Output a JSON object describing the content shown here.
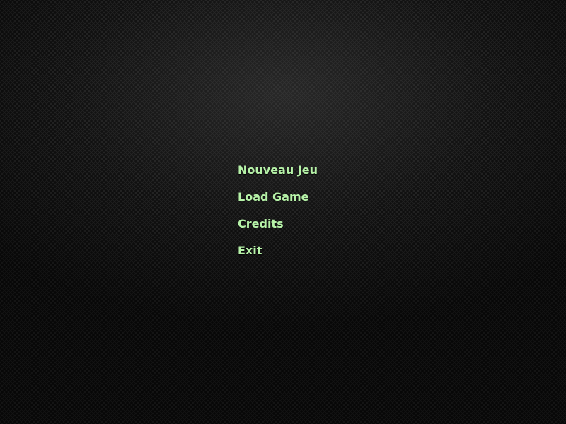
{
  "menu": {
    "items": [
      {
        "label": "Nouveau Jeu"
      },
      {
        "label": "Load Game"
      },
      {
        "label": "Credits"
      },
      {
        "label": "Exit"
      }
    ]
  },
  "colors": {
    "menu_text": "#b6f2a8",
    "background": "#1d1d1d"
  }
}
